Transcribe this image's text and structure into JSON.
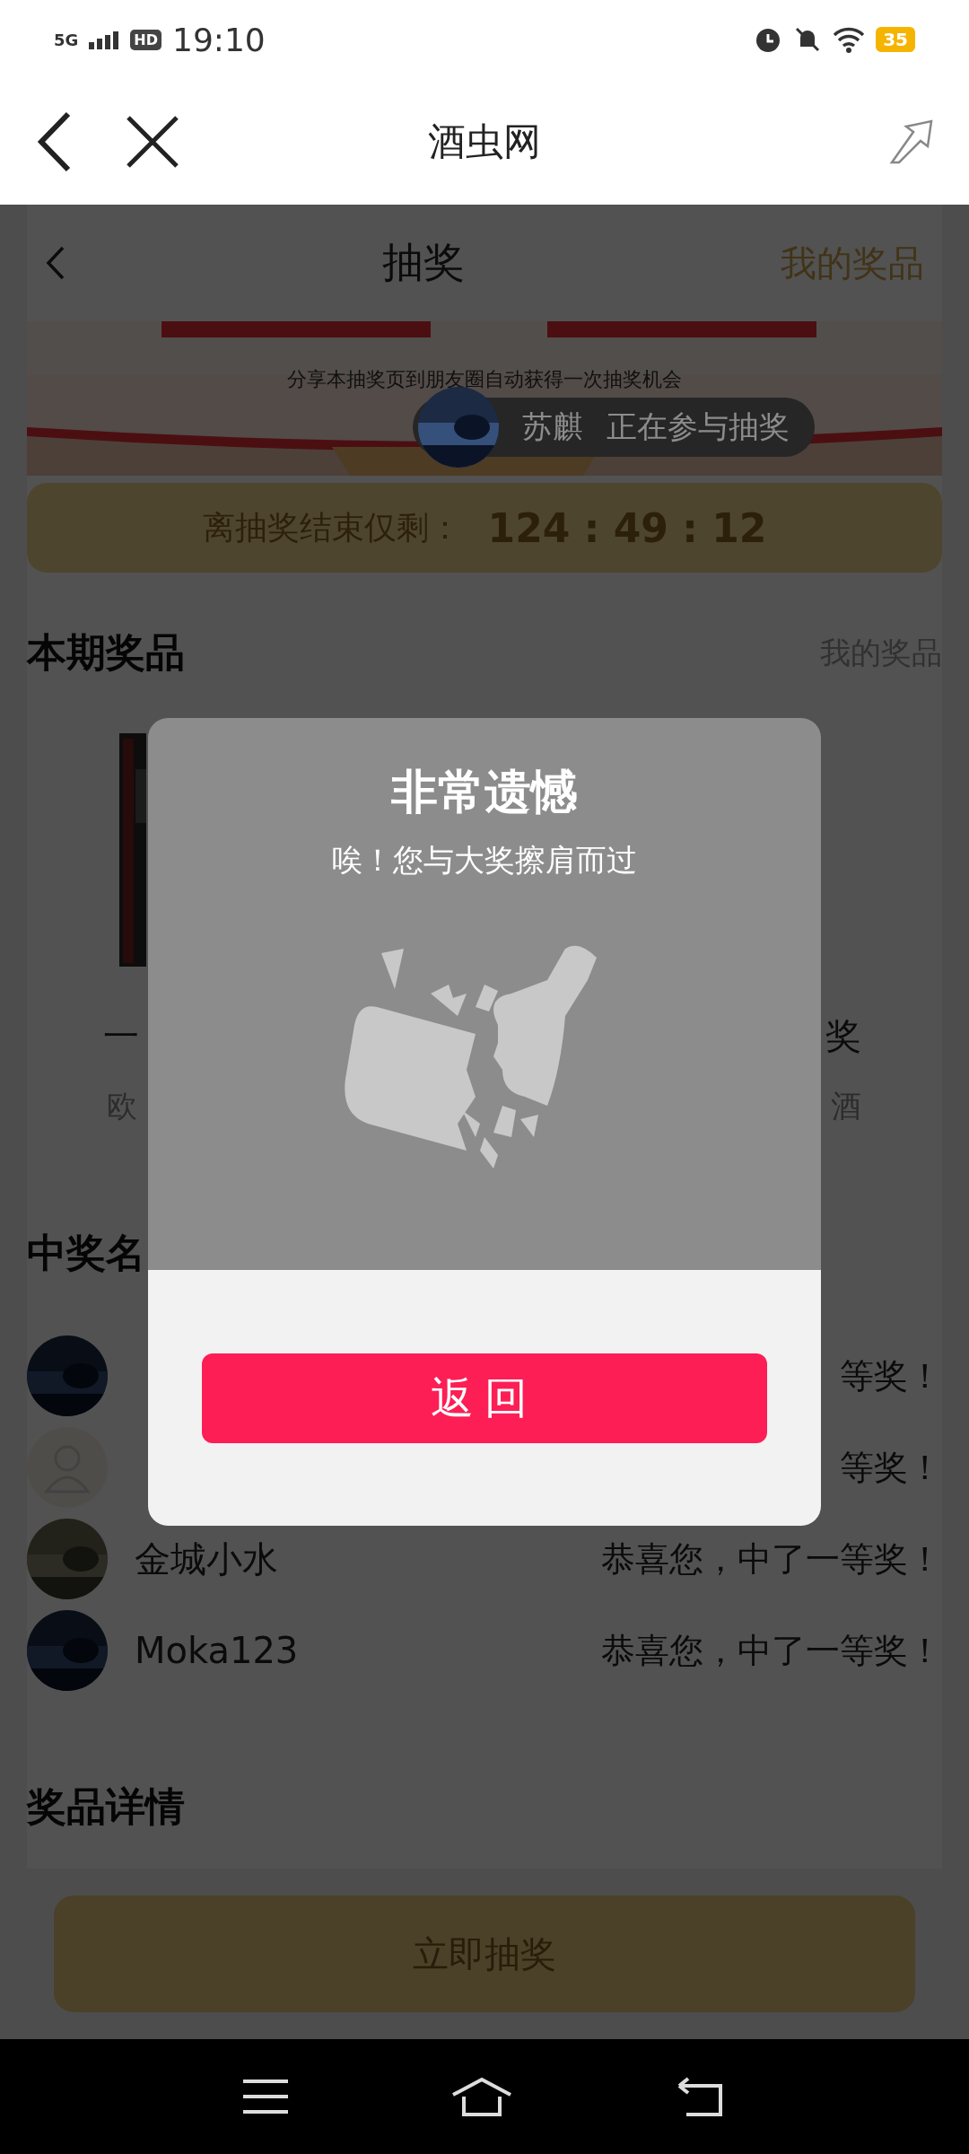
{
  "status_bar": {
    "network": "5G",
    "hd": "HD",
    "time": "19:10",
    "battery": "35"
  },
  "browser_bar": {
    "title": "酒虫网"
  },
  "page_header": {
    "title": "抽奖",
    "link": "我的奖品"
  },
  "banner": {
    "kind": "picture",
    "caption": "分享本抽奖页到朋友圈自动获得一次抽奖机会"
  },
  "toast": {
    "name": "苏麒",
    "message": "正在参与抽奖"
  },
  "countdown": {
    "label": "离抽奖结束仅剩：",
    "value": "124 : 49 : 12"
  },
  "prizes_section": {
    "title": "本期奖品",
    "link": "我的奖品",
    "items": [
      {
        "title": "一",
        "subtitle": "欧"
      },
      {
        "title": "奖",
        "subtitle": "酒"
      }
    ]
  },
  "winners_section": {
    "title": "中奖名",
    "rows": [
      {
        "message": "等奖！"
      },
      {
        "kind": "default",
        "message": "等奖！"
      },
      {
        "name": "金城小水",
        "message": "恭喜您，中了一等奖！"
      },
      {
        "name": "Moka123",
        "message": "恭喜您，中了一等奖！"
      }
    ]
  },
  "details_section": {
    "title": "奖品详情"
  },
  "draw_button": {
    "label": "立即抽奖"
  },
  "dialog": {
    "title": "非常遗憾",
    "message": "唉！您与大奖擦肩而过",
    "button": "返回"
  }
}
